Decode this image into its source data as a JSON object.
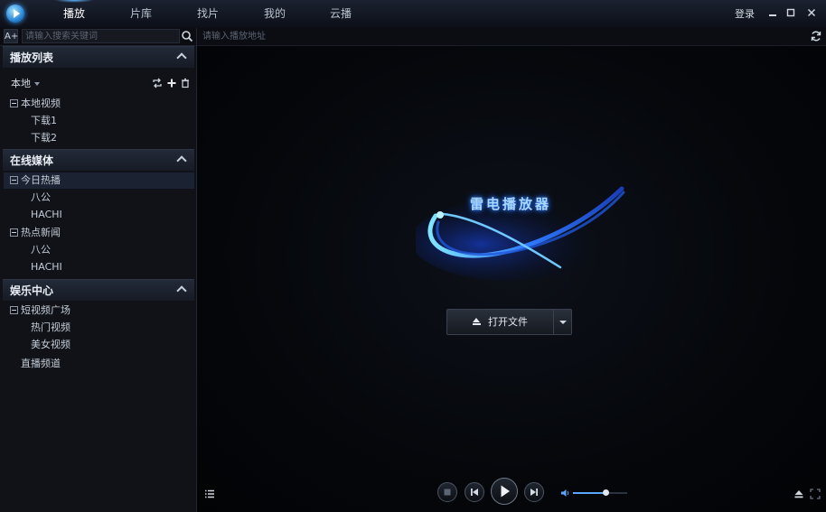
{
  "nav": {
    "tabs": [
      {
        "label": "播放",
        "active": true
      },
      {
        "label": "片库",
        "active": false
      },
      {
        "label": "找片",
        "active": false
      },
      {
        "label": "我的",
        "active": false
      },
      {
        "label": "云播",
        "active": false
      }
    ],
    "login_label": "登录",
    "window_buttons": [
      "minimize-icon",
      "maximize-icon",
      "close-icon"
    ]
  },
  "sidebar": {
    "font_button": "A+",
    "search_placeholder": "请输入搜索关键词",
    "sections": [
      {
        "title": "播放列表"
      },
      {
        "title": "在线媒体"
      },
      {
        "title": "娱乐中心"
      }
    ],
    "source_label": "本地",
    "local": {
      "group": "本地视频",
      "items": [
        "下载1",
        "下载2"
      ]
    },
    "online": [
      {
        "group": "今日热播",
        "items": [
          "八公",
          "HACHI"
        ]
      },
      {
        "group": "热点新闻",
        "items": [
          "八公",
          "HACHI"
        ]
      }
    ],
    "entertainment": {
      "group": "短视频广场",
      "items": [
        "热门视频",
        "美女视频"
      ],
      "extra": "直播频道"
    }
  },
  "address": {
    "placeholder": "请输入播放地址"
  },
  "player": {
    "brand": "雷电播放器",
    "open_file_label": "打开文件",
    "volume": 0.6
  },
  "colors": {
    "accent": "#5aa6ff",
    "background": "#000000",
    "sidebar": "#101217"
  }
}
